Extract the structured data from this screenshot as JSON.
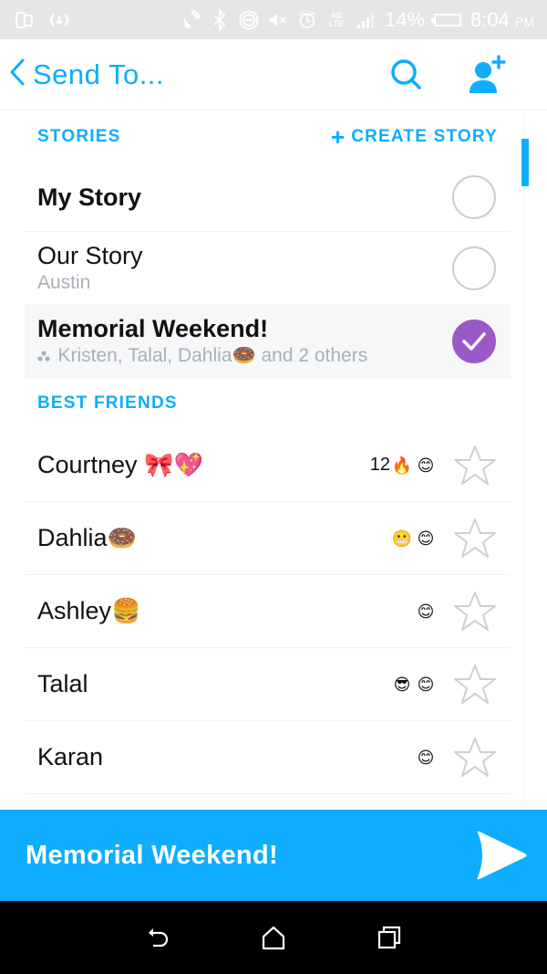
{
  "status_bar": {
    "battery": "14%",
    "time": "8:04",
    "ampm": "PM",
    "network": "4G LTE",
    "icons": [
      "screen-mirror-icon",
      "sync-icon",
      "nfc-icon",
      "bluetooth-icon",
      "do-not-disturb-icon",
      "mute-icon",
      "alarm-icon",
      "network-4g-icon",
      "signal-icon",
      "battery-charging-icon"
    ]
  },
  "header": {
    "title": "Send To...",
    "back_icon": "chevron-left-icon",
    "search_icon": "search-icon",
    "add_friend_icon": "add-friend-icon"
  },
  "stories": {
    "section_label": "STORIES",
    "create_label": "CREATE STORY",
    "create_plus": "+",
    "items": [
      {
        "name": "My Story",
        "subtitle": null,
        "selected": false
      },
      {
        "name": "Our Story",
        "subtitle": "Austin",
        "selected": false
      },
      {
        "name": "Memorial Weekend!",
        "subtitle": "Kristen, Talal, Dahlia🍩 and 2 others",
        "group_icon": "group-icon",
        "selected": true
      }
    ]
  },
  "best_friends": {
    "section_label": "BEST FRIENDS",
    "items": [
      {
        "name": "Courtney",
        "name_emoji": "🎀💖",
        "streak": "12",
        "badges": [
          "🔥",
          "😊"
        ]
      },
      {
        "name": "Dahlia",
        "name_emoji": "🍩",
        "streak": "",
        "badges": [
          "😬",
          "😊"
        ]
      },
      {
        "name": "Ashley",
        "name_emoji": "🍔",
        "streak": "",
        "badges": [
          "😊"
        ]
      },
      {
        "name": "Talal",
        "name_emoji": "",
        "streak": "",
        "badges": [
          "😎",
          "😊"
        ]
      },
      {
        "name": "Karan",
        "name_emoji": "",
        "streak": "",
        "badges": [
          "😊"
        ]
      }
    ]
  },
  "send_bar": {
    "label": "Memorial Weekend!",
    "send_icon": "send-arrow-icon"
  },
  "nav_bar": {
    "buttons": [
      "back-icon",
      "home-icon",
      "recents-icon"
    ]
  },
  "colors": {
    "accent": "#0eadff",
    "selected_check": "#9b59c7",
    "status_bar_bg": "#e6e6e6",
    "subtitle_gray": "#aab0b8"
  }
}
